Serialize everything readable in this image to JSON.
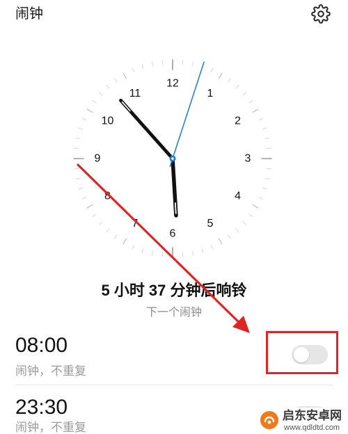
{
  "header": {
    "title": "闹钟",
    "settings_icon": "gear-icon"
  },
  "dial": {
    "numbers": [
      "12",
      "1",
      "2",
      "3",
      "4",
      "5",
      "6",
      "7",
      "8",
      "9",
      "10",
      "11"
    ],
    "time_shown": {
      "hour": 5,
      "minute": 53,
      "second": 3
    }
  },
  "next_alarm": {
    "countdown": "5 小时 37 分钟后响铃",
    "caption": "下一个闹钟"
  },
  "alarms": [
    {
      "time": "08:00",
      "description": "闹钟，不重复",
      "enabled": false
    },
    {
      "time": "23:30",
      "description": "闹钟，不重复"
    }
  ],
  "watermark": {
    "name": "启东安卓网",
    "url": "www.qdldtd.com",
    "logo_icon": "watermark-logo-icon"
  },
  "colors": {
    "accent": "#1a7bd6",
    "hands": "#111111",
    "annotation": "#e02424",
    "toggle_off": "#e6e6e6",
    "watermark_logo": "#f07a1a"
  }
}
